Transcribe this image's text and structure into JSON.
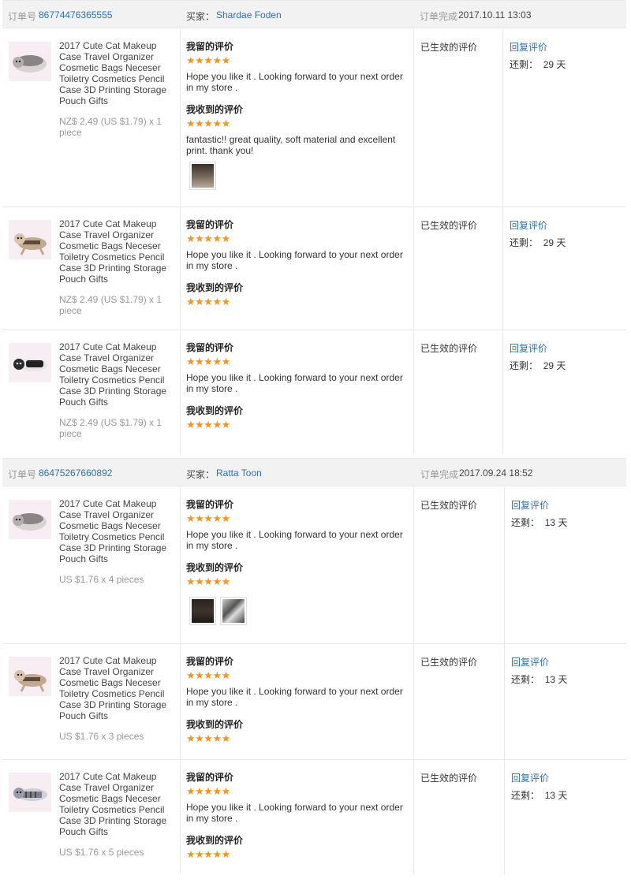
{
  "labels": {
    "order_no": "订单号",
    "buyer": "买家：",
    "completed": "订单完成",
    "left_review": "我留的评价",
    "received_review": "我收到的评价",
    "reply": "回复评价",
    "remaining": "还剩：",
    "status": "已生效的评价"
  },
  "product_title": "2017 Cute Cat Makeup Case Travel Organizer Cosmetic Bags Neceser Toiletry Cosmetics Pencil Case 3D Printing Storage Pouch Gifts",
  "seller_reply": "Hope you like it . Looking forward to your next order in my store .",
  "stars": "★★★★★",
  "orders": [
    {
      "order_no": "86774476365555",
      "buyer": "Shardae Foden",
      "completed_at": "2017.10.11 13:03",
      "items": [
        {
          "price": "NZ$ 2.49 (US $1.79) x 1 piece",
          "received_text": "fantastic!! great quality, soft material and excellent print. thank you!",
          "remaining": "29 天"
        },
        {
          "price": "NZ$ 2.49 (US $1.79) x 1 piece",
          "received_text": "",
          "remaining": "29 天"
        },
        {
          "price": "NZ$ 2.49 (US $1.79) x 1 piece",
          "received_text": "",
          "remaining": "29 天"
        }
      ]
    },
    {
      "order_no": "86475267660892",
      "buyer": "Ratta Toon",
      "completed_at": "2017.09.24 18:52",
      "items": [
        {
          "price": "US $1.76 x 4 pieces",
          "received_text": "",
          "remaining": "13 天"
        },
        {
          "price": "US $1.76 x 3 pieces",
          "received_text": "",
          "remaining": "13 天"
        },
        {
          "price": "US $1.76 x 5 pieces",
          "received_text": "",
          "remaining": "13 天"
        }
      ]
    }
  ],
  "colors": {
    "link": "#2c6fb8",
    "star": "#f7941d",
    "header_bg": "#f2f2f2",
    "muted": "#999999"
  }
}
